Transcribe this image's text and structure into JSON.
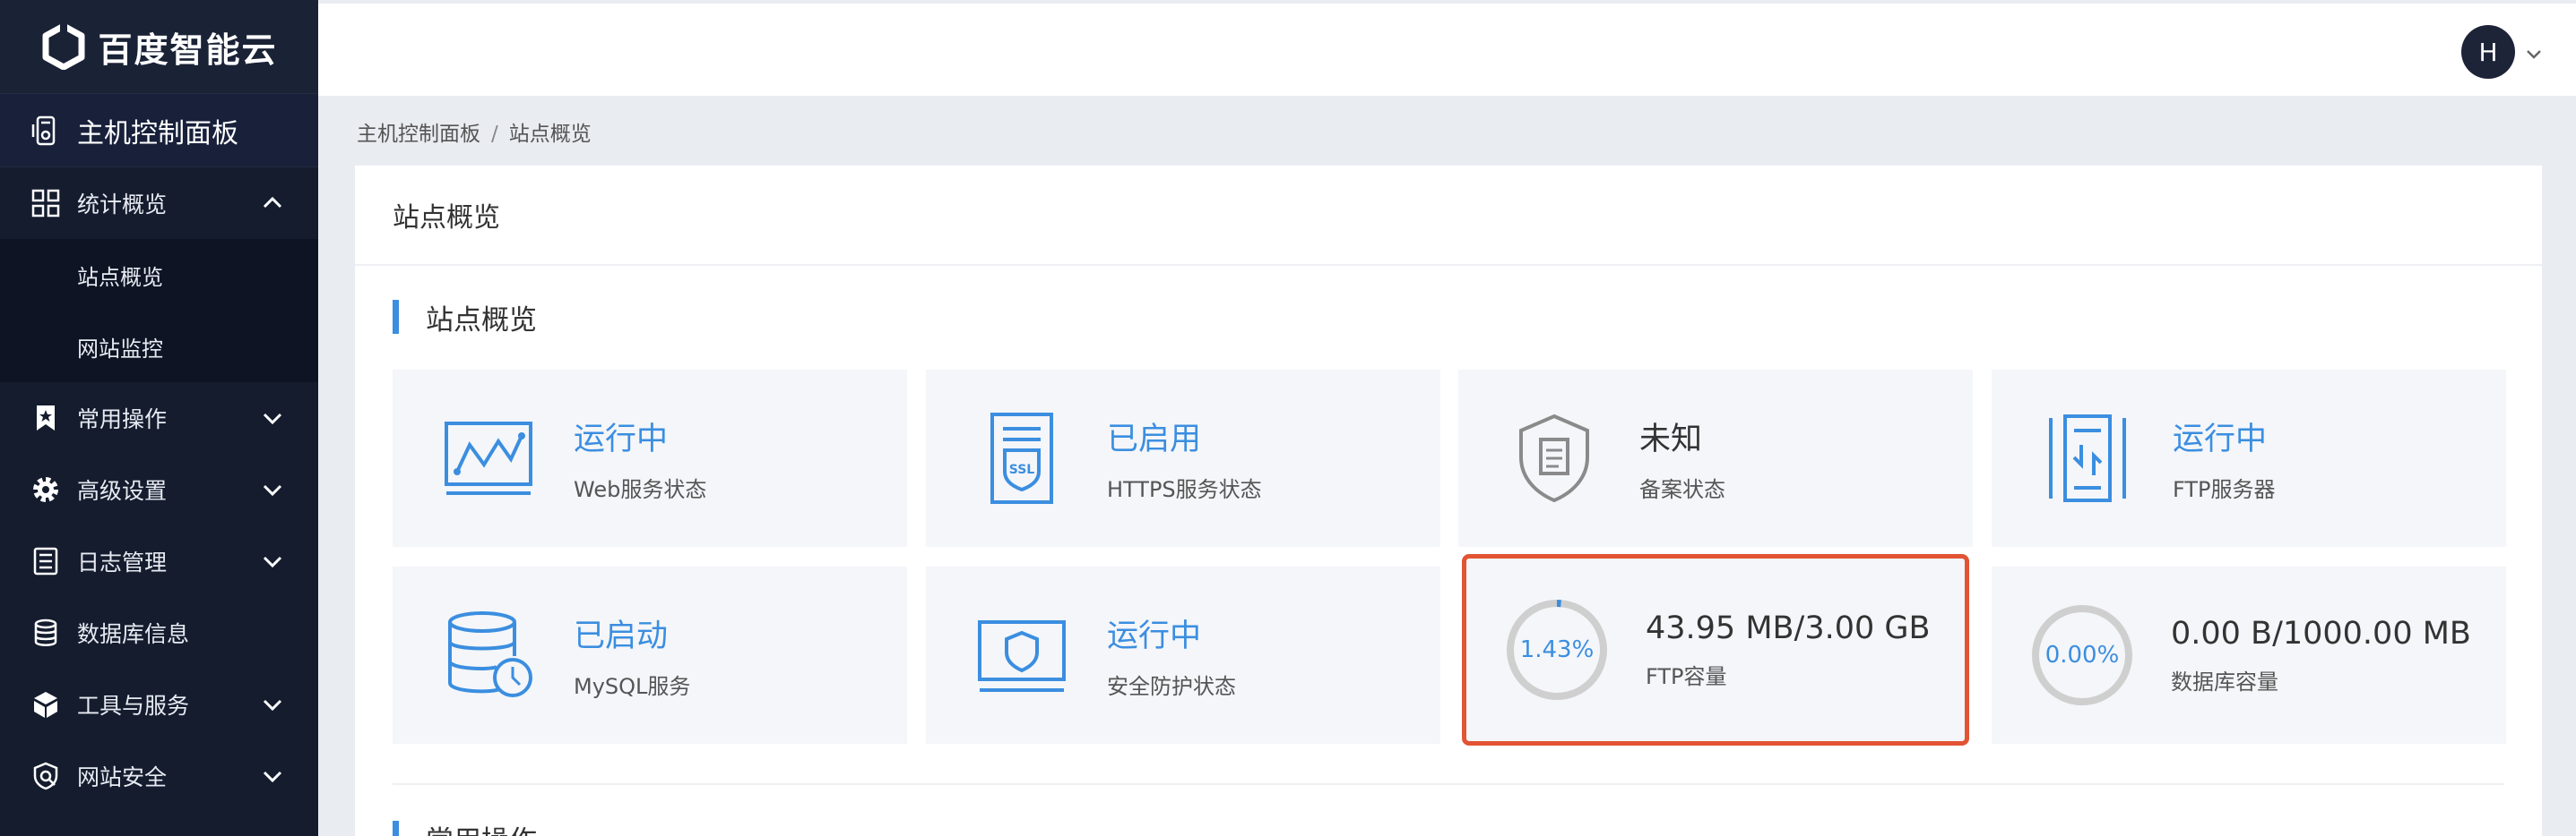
{
  "brand": {
    "name": "百度智能云"
  },
  "sidebar": {
    "panel_label": "主机控制面板",
    "stats": {
      "label": "统计概览",
      "children": [
        {
          "label": "站点概览"
        },
        {
          "label": "网站监控"
        }
      ]
    },
    "items": [
      {
        "label": "常用操作"
      },
      {
        "label": "高级设置"
      },
      {
        "label": "日志管理"
      },
      {
        "label": "数据库信息"
      },
      {
        "label": "工具与服务"
      },
      {
        "label": "网站安全"
      }
    ]
  },
  "header": {
    "avatar_initial": "H"
  },
  "breadcrumb": {
    "root": "主机控制面板",
    "separator": "/",
    "current": "站点概览"
  },
  "card": {
    "title": "站点概览",
    "section_title": "站点概览",
    "next_section_title": "常用操作"
  },
  "tiles": [
    {
      "value": "运行中",
      "caption": "Web服务状态",
      "icon": "web-monitor-icon"
    },
    {
      "value": "已启用",
      "caption": "HTTPS服务状态",
      "icon": "ssl-certificate-icon"
    },
    {
      "value": "未知",
      "caption": "备案状态",
      "icon": "shield-document-icon"
    },
    {
      "value": "运行中",
      "caption": "FTP服务器",
      "icon": "ftp-server-icon"
    },
    {
      "value": "已启动",
      "caption": "MySQL服务",
      "icon": "database-clock-icon"
    },
    {
      "value": "运行中",
      "caption": "安全防护状态",
      "icon": "monitor-shield-icon"
    },
    {
      "value": "43.95 MB/3.00 GB",
      "caption": "FTP容量",
      "percent_label": "1.43%",
      "percent": 1.43
    },
    {
      "value": "0.00 B/1000.00 MB",
      "caption": "数据库容量",
      "percent_label": "0.00%",
      "percent": 0.0
    }
  ],
  "colors": {
    "accent": "#3b8ee0",
    "sidebar_bg": "#141c2e",
    "highlight_border": "#e25434",
    "ring_track": "#cfcfcf"
  }
}
